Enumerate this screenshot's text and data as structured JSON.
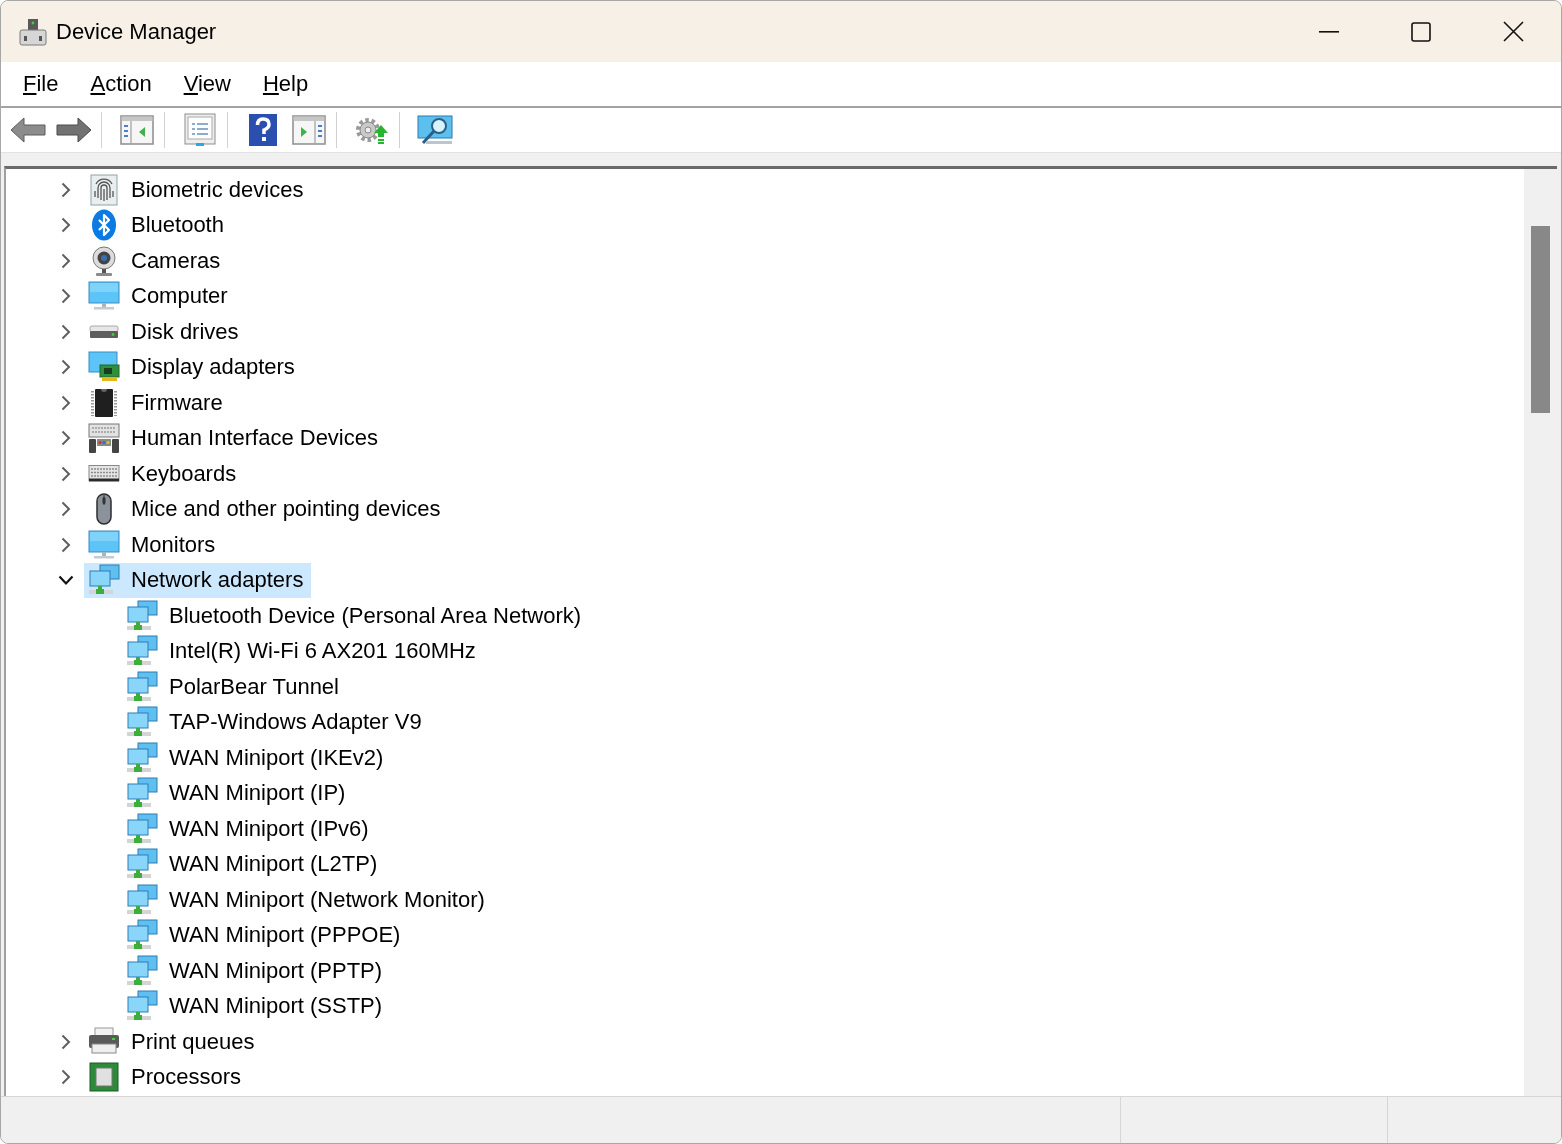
{
  "window": {
    "title": "Device Manager"
  },
  "menu": [
    "File",
    "Action",
    "View",
    "Help"
  ],
  "tree": {
    "items": [
      {
        "label": "Biometric devices",
        "kind": "fingerprint",
        "expanded": false,
        "selected": false
      },
      {
        "label": "Bluetooth",
        "kind": "bluetooth",
        "expanded": false,
        "selected": false
      },
      {
        "label": "Cameras",
        "kind": "camera",
        "expanded": false,
        "selected": false
      },
      {
        "label": "Computer",
        "kind": "computer",
        "expanded": false,
        "selected": false
      },
      {
        "label": "Disk drives",
        "kind": "disk",
        "expanded": false,
        "selected": false
      },
      {
        "label": "Display adapters",
        "kind": "display",
        "expanded": false,
        "selected": false
      },
      {
        "label": "Firmware",
        "kind": "chip",
        "expanded": false,
        "selected": false
      },
      {
        "label": "Human Interface Devices",
        "kind": "hid",
        "expanded": false,
        "selected": false
      },
      {
        "label": "Keyboards",
        "kind": "keyboard",
        "expanded": false,
        "selected": false
      },
      {
        "label": "Mice and other pointing devices",
        "kind": "mouse",
        "expanded": false,
        "selected": false
      },
      {
        "label": "Monitors",
        "kind": "monitor",
        "expanded": false,
        "selected": false
      },
      {
        "label": "Network adapters",
        "kind": "network",
        "expanded": true,
        "selected": true,
        "children": [
          {
            "label": "Bluetooth Device (Personal Area Network)",
            "kind": "network",
            "selected": false
          },
          {
            "label": "Intel(R) Wi-Fi 6 AX201 160MHz",
            "kind": "network",
            "selected": false
          },
          {
            "label": "PolarBear Tunnel",
            "kind": "network",
            "selected": false
          },
          {
            "label": "TAP-Windows Adapter V9",
            "kind": "network",
            "selected": false
          },
          {
            "label": "WAN Miniport (IKEv2)",
            "kind": "network",
            "selected": false
          },
          {
            "label": "WAN Miniport (IP)",
            "kind": "network",
            "selected": false
          },
          {
            "label": "WAN Miniport (IPv6)",
            "kind": "network",
            "selected": false
          },
          {
            "label": "WAN Miniport (L2TP)",
            "kind": "network",
            "selected": false
          },
          {
            "label": "WAN Miniport (Network Monitor)",
            "kind": "network",
            "selected": false
          },
          {
            "label": "WAN Miniport (PPPOE)",
            "kind": "network",
            "selected": false
          },
          {
            "label": "WAN Miniport (PPTP)",
            "kind": "network",
            "selected": false
          },
          {
            "label": "WAN Miniport (SSTP)",
            "kind": "network",
            "selected": false
          }
        ]
      },
      {
        "label": "Print queues",
        "kind": "printer",
        "expanded": false,
        "selected": false
      },
      {
        "label": "Processors",
        "kind": "processor",
        "expanded": false,
        "selected": false
      }
    ]
  }
}
